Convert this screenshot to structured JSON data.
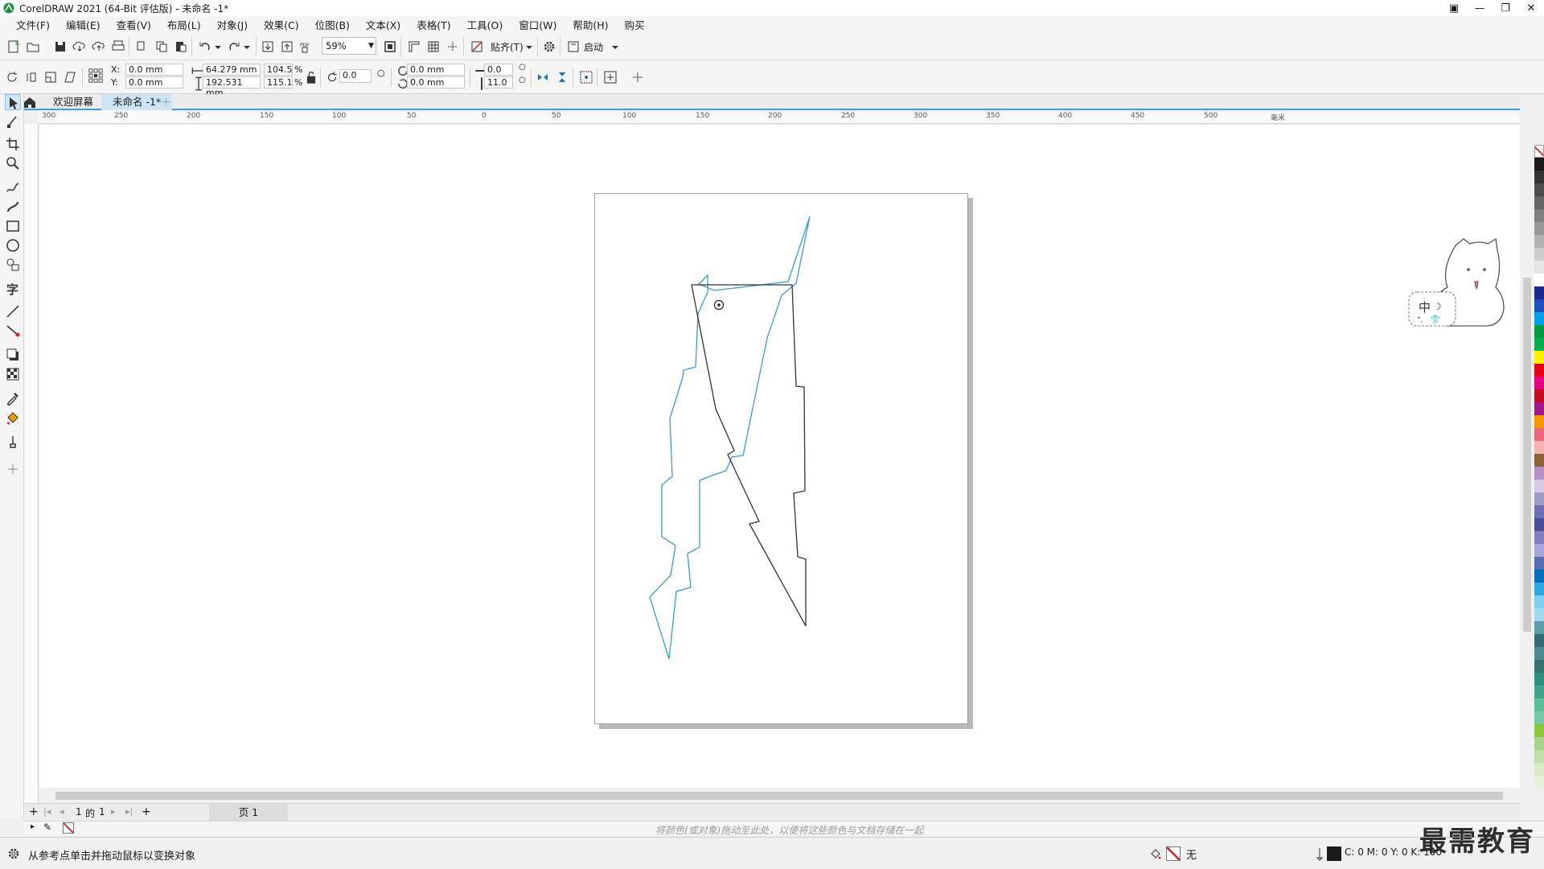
{
  "window": {
    "title": "CorelDRAW 2021 (64-Bit 评估版) - 未命名 -1*"
  },
  "menu": [
    "文件(F)",
    "编辑(E)",
    "查看(V)",
    "布局(L)",
    "对象(J)",
    "效果(C)",
    "位图(B)",
    "文本(X)",
    "表格(T)",
    "工具(O)",
    "窗口(W)",
    "帮助(H)",
    "购买"
  ],
  "toolbar": {
    "zoom": "59%",
    "snap_label": "贴齐(T)",
    "launch_label": "启动"
  },
  "property_bar": {
    "x_label": "X:",
    "x_value": "0.0 mm",
    "y_label": "Y:",
    "y_value": "0.0 mm",
    "width_value": "64.279 mm",
    "height_value": "192.531 mm",
    "scale_x": "104.5",
    "scale_y": "115.1",
    "percent": "%",
    "rotation": "0.0",
    "skew_1": "0.0 mm",
    "skew_2": "0.0 mm",
    "outline_1": "0.0",
    "outline_2": "11.0"
  },
  "doc_tabs": [
    "欢迎屏幕",
    "未命名 -1*"
  ],
  "ruler_h_ticks": [
    "300",
    "250",
    "200",
    "150",
    "100",
    "50",
    "0",
    "50",
    "100",
    "150",
    "200",
    "250",
    "300",
    "350",
    "400",
    "450",
    "500"
  ],
  "ruler_h_unit": "毫米",
  "page_nav": {
    "position": "1",
    "of": "的",
    "total": "1",
    "page_tab": "页 1"
  },
  "doc_palette_hint": "将颜色(或对象)拖动至此处，以便将这些颜色与文档存储在一起",
  "status": {
    "message": "从参考点单击并拖动鼠标以变换对象",
    "fill": "无",
    "color_readout": "C: 0 M: 0 Y: 0 K: 100"
  },
  "mascot_text": "中",
  "watermark": "最需教育",
  "colors": {
    "accent": "#3d9fe0",
    "shape_blue": "#3a9ad9",
    "shape_dark": "#333333"
  },
  "palette": [
    "#ffffff",
    "#1a1a1a",
    "#333333",
    "#4d4d4d",
    "#666666",
    "#808080",
    "#999999",
    "#b3b3b3",
    "#cccccc",
    "#e6e6e6",
    "#ffffff",
    "#1a2b8c",
    "#1f4fbf",
    "#00a0e9",
    "#009944",
    "#00b050",
    "#fff100",
    "#e60012",
    "#e4007f",
    "#c30d23",
    "#a0168c",
    "#f39800",
    "#eb6877",
    "#f5b2b2",
    "#8c6239",
    "#b58fc3",
    "#d6c7e4",
    "#9e9ac8",
    "#6c6fb4",
    "#4c4c99",
    "#7f7fbf",
    "#a6a6d9",
    "#556fb5",
    "#0072bc",
    "#2ea7e0",
    "#7ecef4",
    "#a0d8ef",
    "#5a9ea8",
    "#386b70",
    "#4c8c8c",
    "#35746b",
    "#2f8f83",
    "#40a58b",
    "#5cbd9b",
    "#78c8a8",
    "#8cc63f",
    "#a6d38a",
    "#c0dfa8",
    "#d7ebc6",
    "#e7f2dc"
  ]
}
